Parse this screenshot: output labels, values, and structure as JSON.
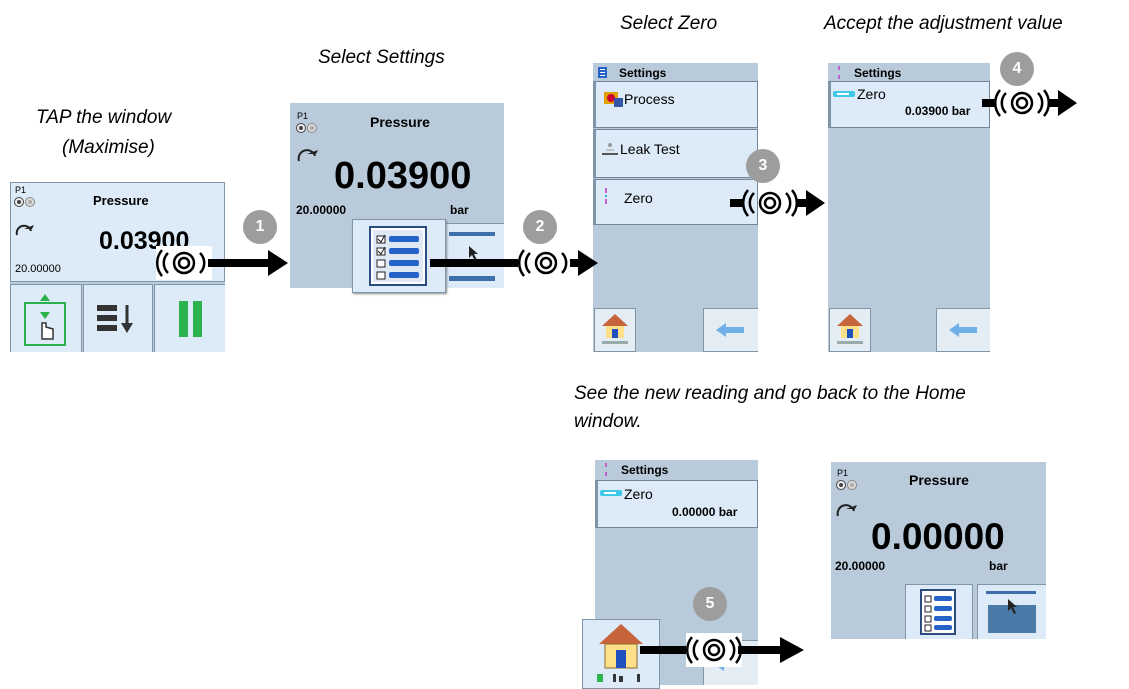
{
  "captions": {
    "step1_line1": "TAP the window",
    "step1_line2": "(Maximise)",
    "step2": "Select Settings",
    "step3": "Select Zero",
    "step4": "Accept the adjustment value",
    "step5_line1": "See the new reading and go back to the Home",
    "step5_line2": "window."
  },
  "steps": [
    "1",
    "2",
    "3",
    "4",
    "5"
  ],
  "screen_home": {
    "port": "P1",
    "title": "Pressure",
    "value": "0.03900",
    "range": "20.00000"
  },
  "screen_pressure": {
    "port": "P1",
    "title": "Pressure",
    "value": "0.03900",
    "range": "20.00000",
    "unit": "bar"
  },
  "screen_settings": {
    "header": "Settings",
    "items": [
      "Process",
      "Leak Test",
      "Zero"
    ]
  },
  "screen_zero": {
    "header": "Settings",
    "item": "Zero",
    "value": "0.03900 bar"
  },
  "screen_zero_new": {
    "header": "Settings",
    "item": "Zero",
    "value": "0.00000 bar"
  },
  "screen_final": {
    "port": "P1",
    "title": "Pressure",
    "value": "0.00000",
    "range": "20.00000",
    "unit": "bar"
  },
  "colors": {
    "screen_bg": "#b9cbdb",
    "item_bg": "#dcebf7",
    "badge": "#9d9d9d",
    "accent_green": "#2bb24c",
    "accent_blue": "#2563c9"
  }
}
